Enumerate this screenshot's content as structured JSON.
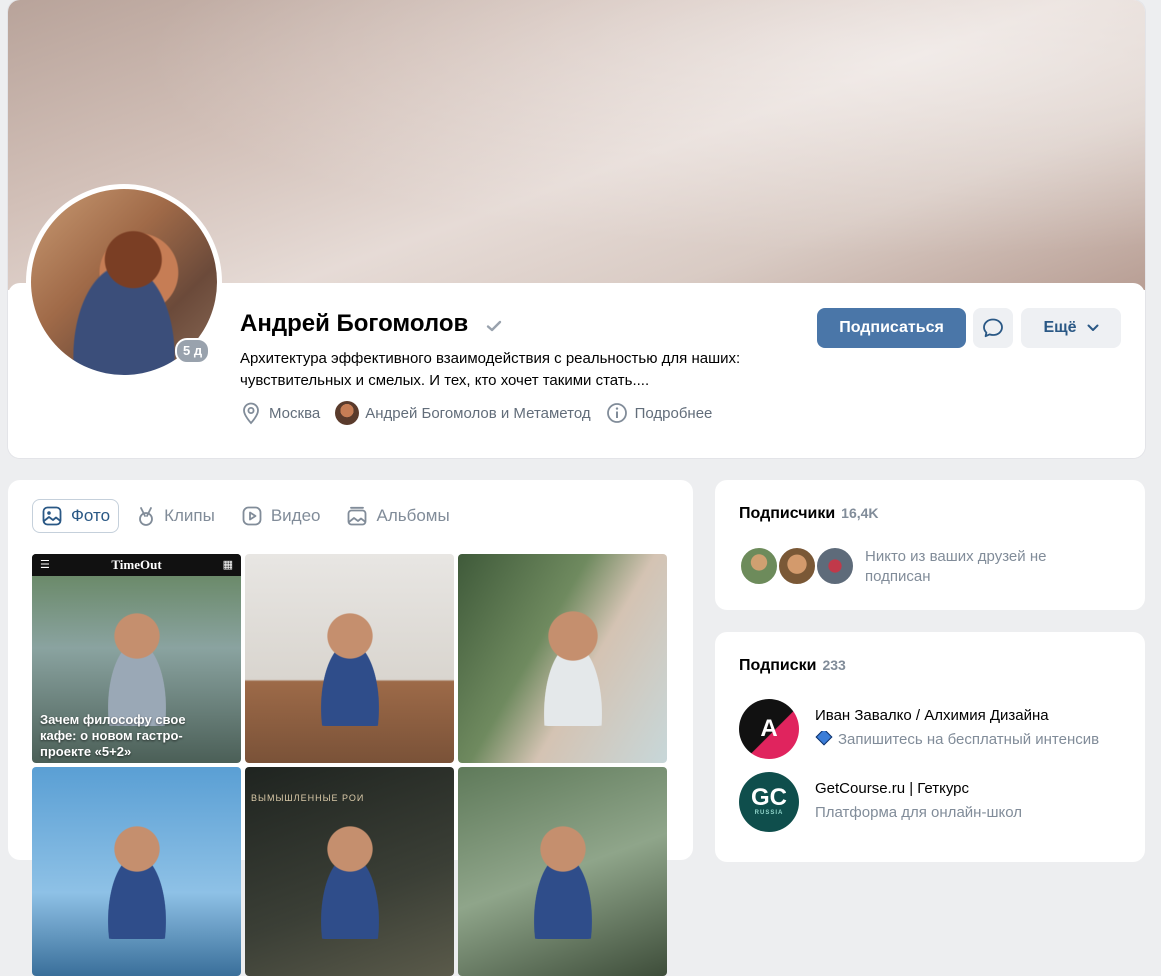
{
  "profile": {
    "name": "Андрей Богомолов",
    "online_badge": "5 д",
    "status": "Архитектура эффективного взаимодействия с реальностью для наших: чувствительных и смелых. И тех, кто хочет такими стать....",
    "city": "Москва",
    "work": "Андрей Богомолов и Метаметод",
    "details": "Подробнее"
  },
  "actions": {
    "subscribe": "Подписаться",
    "more": "Ещё"
  },
  "media": {
    "tabs": [
      {
        "label": "Фото",
        "icon": "photo-icon",
        "active": true
      },
      {
        "label": "Клипы",
        "icon": "clips-icon"
      },
      {
        "label": "Видео",
        "icon": "video-icon"
      },
      {
        "label": "Альбомы",
        "icon": "albums-icon"
      }
    ],
    "photos": [
      {
        "brand": "TimeOut",
        "caption": "Зачем философу свое кафе: о новом гастро-проекте «5+2»"
      },
      {},
      {},
      {},
      {
        "overlay_text": "ВЫМЫШЛЕННЫЕ РОИ"
      },
      {}
    ]
  },
  "followers": {
    "title": "Подписчики",
    "count": "16,4K",
    "note": "Никто из ваших друзей не подписан"
  },
  "subscriptions": {
    "title": "Подписки",
    "count": "233",
    "items": [
      {
        "name": "Иван Завалко / Алхимия Дизайна",
        "desc": "Запишитесь на бесплатный интенсив",
        "avatar_text": "A"
      },
      {
        "name": "GetCourse.ru | Геткурс",
        "desc": "Платформа для онлайн-школ",
        "avatar_text": "GC",
        "avatar_sub": "RUSSIA"
      }
    ]
  },
  "colors": {
    "accent": "#4a76a8",
    "link": "#2a5885",
    "muted": "#818c99",
    "background": "#edeef0"
  }
}
